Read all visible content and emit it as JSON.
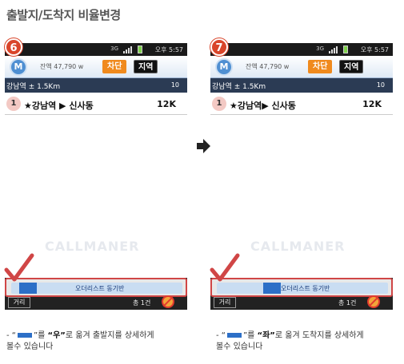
{
  "page_title": "출발지/도착지 비율변경",
  "panels": [
    {
      "step": "6",
      "status": {
        "network": "3G",
        "time": "오후 5:57"
      },
      "app": {
        "balance": "잔액 47,790 w",
        "block_button": "차단",
        "region_button": "지역"
      },
      "location": {
        "name": "강남역 ± 1.5Km",
        "count": "10"
      },
      "order": {
        "number": "1",
        "route": "★강남역 ▶ 신사동",
        "price": "12K"
      },
      "watermark": "CALLMANER",
      "ticker": {
        "text": "오더리스트 동기반",
        "position": 0.05
      },
      "distance_button": "거리",
      "count_text": "총 1건"
    },
    {
      "step": "7",
      "status": {
        "network": "3G",
        "time": "오후 5:57"
      },
      "app": {
        "balance": "잔액 47,790 w",
        "block_button": "차단",
        "region_button": "지역"
      },
      "location": {
        "name": "강남역 ± 1.5Km",
        "count": "10"
      },
      "order": {
        "number": "1",
        "route": "★강남역▶ 신사동",
        "price": "12K"
      },
      "watermark": "CALLMANER",
      "ticker": {
        "text": "오더리스트 동기반",
        "position": 0.3
      },
      "distance_button": "거리",
      "count_text": "총 1건"
    }
  ],
  "captions": [
    {
      "prefix": "- “",
      "middle": "”를 ",
      "direction": "“우”",
      "suffix": "로 옮겨 출발지를 상세하게",
      "line2": "볼수 있습니다"
    },
    {
      "prefix": "- “",
      "middle": "”를 ",
      "direction": "“좌”",
      "suffix": "로 옮겨 도착지를 상세하게",
      "line2": "볼수 있습니다"
    }
  ],
  "colors": {
    "accent": "#d04646",
    "ticker": "#2c6fc7",
    "orange": "#f08a1d"
  }
}
